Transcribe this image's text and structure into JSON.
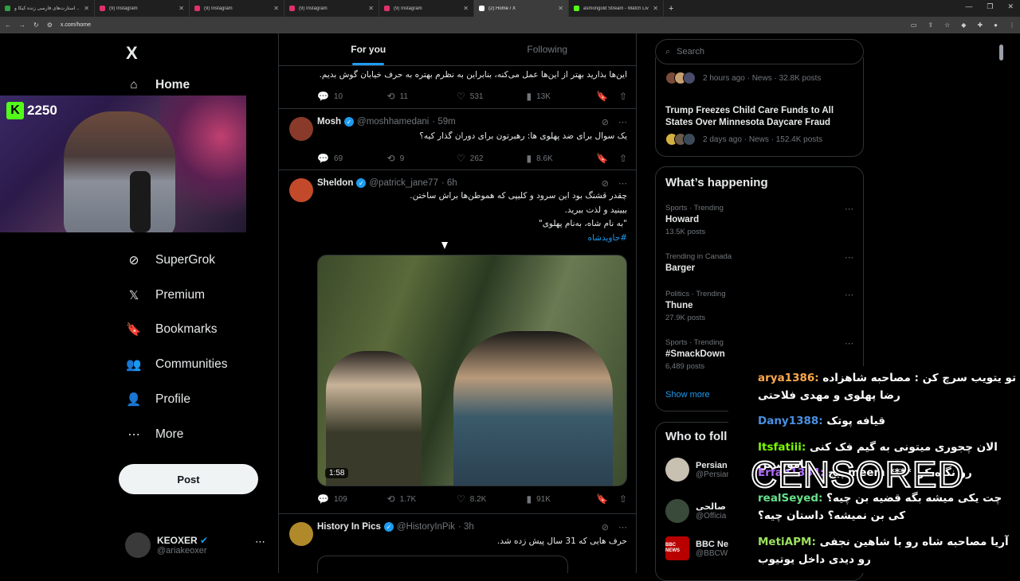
{
  "browser": {
    "tabs": [
      {
        "title": "استارت‌های فارسی زنده کیکا و ...",
        "color": "#2ea043",
        "active": false
      },
      {
        "title": "(9) Instagram",
        "color": "#e1306c",
        "active": false
      },
      {
        "title": "(9) Instagram",
        "color": "#e1306c",
        "active": false
      },
      {
        "title": "(9) Instagram",
        "color": "#e1306c",
        "active": false
      },
      {
        "title": "(9) Instagram",
        "color": "#e1306c",
        "active": false
      },
      {
        "title": "(2) Home / X",
        "color": "#ffffff",
        "active": true
      },
      {
        "title": "asmongold Stream - Watch Liv...",
        "color": "#53fc18",
        "active": false
      }
    ],
    "new_tab": "+",
    "url": "x.com/home"
  },
  "left_nav": {
    "logo": "X",
    "items": [
      {
        "label": "Home",
        "icon": "home-icon",
        "glyph": "⌂"
      },
      {
        "label": "SuperGrok",
        "icon": "grok-icon",
        "glyph": "⊘"
      },
      {
        "label": "Premium",
        "icon": "x-premium-icon",
        "glyph": "𝕏"
      },
      {
        "label": "Bookmarks",
        "icon": "bookmark-icon",
        "glyph": "🔖"
      },
      {
        "label": "Communities",
        "icon": "communities-icon",
        "glyph": "👥"
      },
      {
        "label": "Profile",
        "icon": "profile-icon",
        "glyph": "👤"
      },
      {
        "label": "More",
        "icon": "more-icon",
        "glyph": "⋯"
      }
    ],
    "post_label": "Post",
    "account": {
      "name": "KEOXER",
      "handle": "@ariakeoxer"
    }
  },
  "stream_overlay": {
    "platform_badge": "K",
    "count": "2250"
  },
  "feed": {
    "tabs": [
      "For you",
      "Following"
    ],
    "active_tab": 0,
    "tweets": [
      {
        "text": "این‌ها بذارید بهتر از این‌ها عمل می‌کنه، بنابراین به نظرم بهتره به حرف خیابان گوش بدیم.",
        "replies": "10",
        "reposts": "11",
        "likes": "531",
        "views": "13K"
      },
      {
        "name": "Mosh",
        "handle": "@moshhamedani",
        "time": "· 59m",
        "text": "یک سوال برای ضد پهلوی ها: رهبرتون برای دوران گذار کیه؟",
        "replies": "69",
        "reposts": "9",
        "likes": "262",
        "views": "8.6K"
      },
      {
        "name": "Sheldon",
        "handle": "@patrick_jane77",
        "time": "· 6h",
        "lines": [
          "چقدر قشنگ بود این سرود و کلیپی که هموطن‌ها براش ساختن.",
          "ببینید و لذت ببرید.",
          "\"به نام شاه، به‌نام پهلوی\""
        ],
        "hashtag": "#جاویدشاه",
        "duration": "1:58",
        "replies": "109",
        "reposts": "1.7K",
        "likes": "8.2K",
        "views": "91K"
      },
      {
        "name": "History In Pics",
        "handle": "@HistoryInPik",
        "time": "· 3h",
        "text": "حرف هایی که 31 سال پیش زده شد."
      }
    ]
  },
  "right": {
    "search_placeholder": "Search",
    "news": [
      {
        "meta": "2 hours ago · News · 32.8K posts"
      },
      {
        "title": "Trump Freezes Child Care Funds to All States Over Minnesota Daycare Fraud",
        "meta": "2 days ago · News · 152.4K posts"
      }
    ],
    "happening_title": "What’s happening",
    "trends": [
      {
        "context": "Sports · Trending",
        "title": "Howard",
        "count": "13.5K posts"
      },
      {
        "context": "Trending in Canada",
        "title": "Barger",
        "count": ""
      },
      {
        "context": "Politics · Trending",
        "title": "Thune",
        "count": "27.9K posts"
      },
      {
        "context": "Sports · Trending",
        "title": "#SmackDown",
        "count": "6,489 posts"
      }
    ],
    "show_more": "Show more",
    "wtf_title": "Who to foll",
    "wtf": [
      {
        "name": "Persian",
        "handle": "@Persiar"
      },
      {
        "name": "اج صالحی",
        "handle": "@Officia"
      },
      {
        "name": "BBC New",
        "handle": "@BBCW",
        "logo_text": "BBC NEWS"
      }
    ]
  },
  "chat": {
    "messages": [
      {
        "user": "arya1386:",
        "user_color": "#ffa94d",
        "text": "تو یتویب سرچ کن : مصاحبه شاهزاده رضا پهلوی و مهدی فلاحتی"
      },
      {
        "user": "Dany1388:",
        "user_color": "#4a90e2",
        "text": "قیافه پوتک"
      },
      {
        "user": "Itsfatiii:",
        "user_color": "#7cfc00",
        "text": "الان چجوری میتونی به گیم فک کنی ناموصننن"
      },
      {
        "user": "Erfan1384:",
        "user_color": "#b36bff",
        "text": "رو نگاه کن **** meem پیج"
      },
      {
        "user": "realSeyed:",
        "user_color": "#66e08a",
        "text": "چت یکی میشه بگه قضیه بن چیه؟ کی بن نمیشه؟ داستان چیه؟"
      },
      {
        "user": "MetiAPM:",
        "user_color": "#9be15d",
        "text": "آریا مصاحبه شاه رو با شاهین نجفی رو دیدی داخل یوتیوب"
      }
    ],
    "censor_label": "CENSORED"
  }
}
